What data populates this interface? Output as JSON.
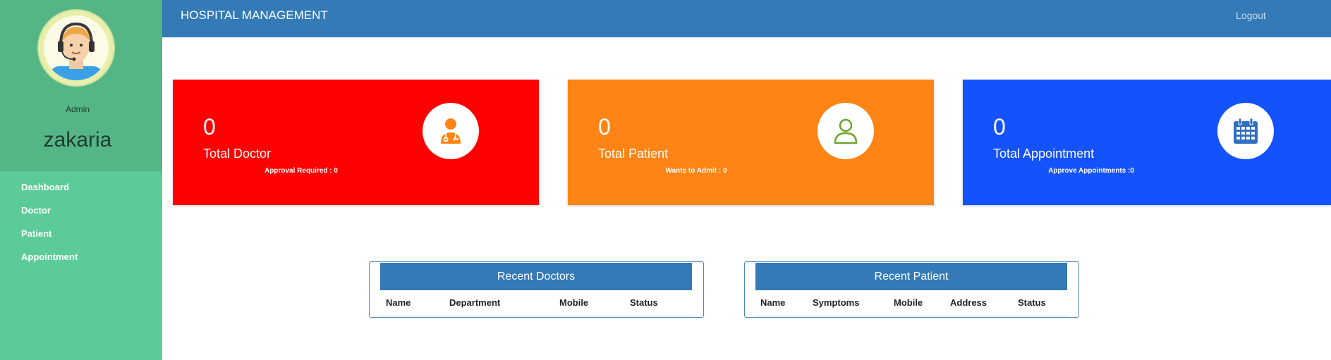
{
  "sidebar": {
    "role": "Admin",
    "username": "zakaria",
    "items": [
      {
        "label": "Dashboard"
      },
      {
        "label": "Doctor"
      },
      {
        "label": "Patient"
      },
      {
        "label": "Appointment"
      }
    ]
  },
  "header": {
    "title": "HOSPITAL MANAGEMENT",
    "logout": "Logout"
  },
  "cards": {
    "doctor": {
      "count": "0",
      "label": "Total Doctor",
      "sub": "Approval Required : 0",
      "icon": "doctor-icon",
      "color": "#ff0000"
    },
    "patient": {
      "count": "0",
      "label": "Total Patient",
      "sub": "Wants to Admit : 0",
      "icon": "user-icon",
      "color": "#fd8415"
    },
    "appointment": {
      "count": "0",
      "label": "Total Appointment",
      "sub": "Approve Appointments :0",
      "icon": "calendar-icon",
      "color": "#1452fb"
    }
  },
  "recent_doctors": {
    "title": "Recent Doctors",
    "columns": [
      "Name",
      "Department",
      "Mobile",
      "Status"
    ]
  },
  "recent_patient": {
    "title": "Recent Patient",
    "columns": [
      "Name",
      "Symptoms",
      "Mobile",
      "Address",
      "Status"
    ]
  },
  "colors": {
    "sidebar": "#5bcc98",
    "profile": "#55b685",
    "header": "#337ab7"
  }
}
